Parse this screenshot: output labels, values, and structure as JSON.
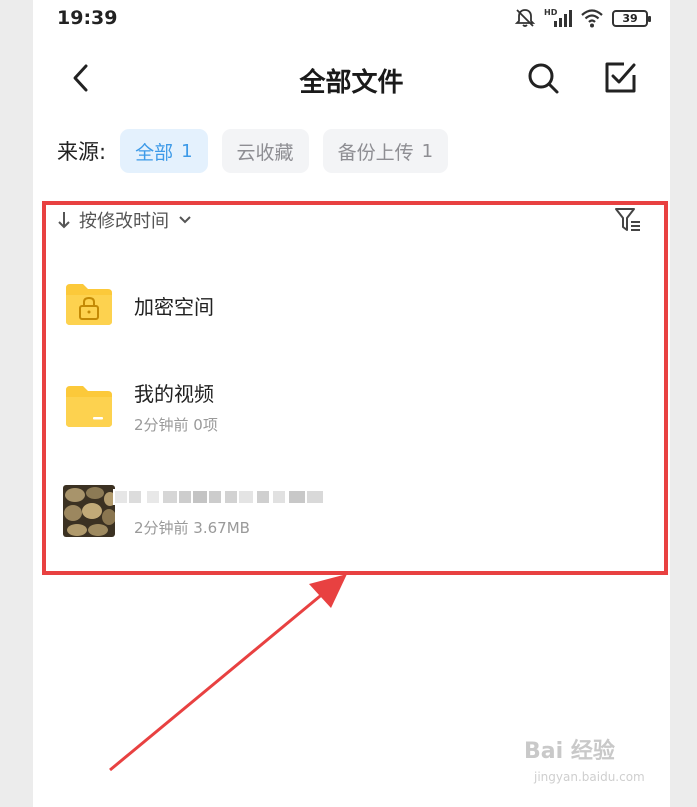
{
  "status_bar": {
    "time": "19:39",
    "battery": "39",
    "icons": [
      "mute-bell-icon",
      "hd-signal-icon",
      "wifi-icon",
      "battery-icon"
    ]
  },
  "header": {
    "title": "全部文件",
    "back_icon": "chevron-left-icon",
    "search_icon": "search-icon",
    "select_icon": "checkbox-icon"
  },
  "source_filter": {
    "label": "来源:",
    "chips": [
      {
        "label": "全部",
        "count": "1",
        "active": true
      },
      {
        "label": "云收藏",
        "count": "",
        "active": false
      },
      {
        "label": "备份上传",
        "count": "1",
        "active": false
      }
    ]
  },
  "sort": {
    "label": "按修改时间",
    "arrow_icon": "arrow-down-icon",
    "dropdown_icon": "chevron-down-icon",
    "filter_icon": "filter-icon"
  },
  "files": [
    {
      "name": "加密空间",
      "meta": "",
      "icon": "locked-folder-icon"
    },
    {
      "name": "我的视频",
      "meta": "2分钟前  0项",
      "icon": "folder-icon"
    },
    {
      "name": "",
      "meta": "2分钟前  3.67MB",
      "icon": "image-thumbnail"
    }
  ],
  "watermark": {
    "brand": "Bai 经验",
    "url": "jingyan.baidu.com"
  },
  "colors": {
    "accent": "#3d9ae8",
    "folder": "#fcc93a",
    "highlight": "#e84141"
  }
}
